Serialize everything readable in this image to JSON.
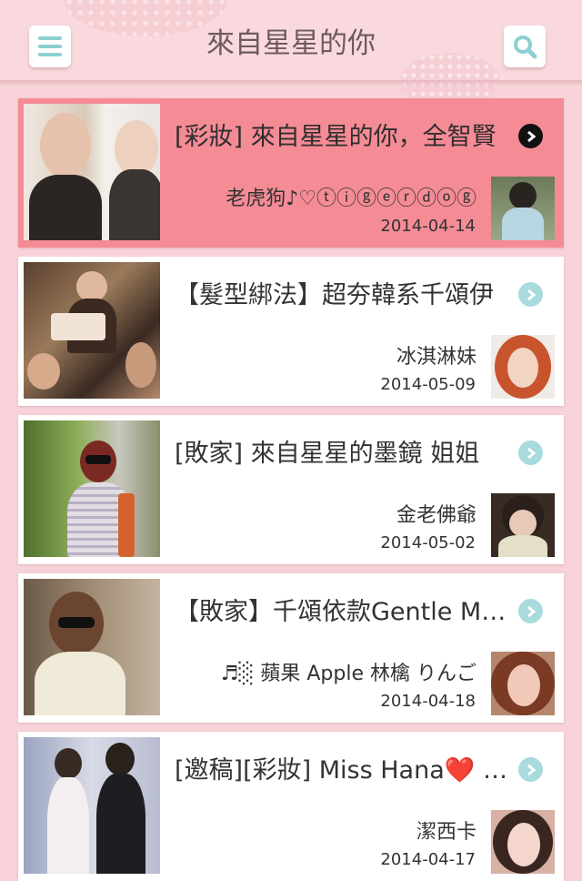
{
  "header": {
    "title": "來自星星的你",
    "menu_icon": "menu-icon",
    "search_icon": "search-icon"
  },
  "colors": {
    "background": "#f7d2d8",
    "selected_row": "#f58b95",
    "accent": "#8ccfd1"
  },
  "posts": [
    {
      "title": "[彩妝] 來自星星的你，全智賢",
      "author": "老虎狗♪♡ⓣⓘⓖⓔⓡⓓⓞⓖ",
      "date": "2014-04-14",
      "selected": true
    },
    {
      "title": "【髮型綁法】超夯韓系千頌伊",
      "author": "冰淇淋妹",
      "date": "2014-05-09",
      "selected": false
    },
    {
      "title": "[敗家] 來自星星的墨鏡  姐姐",
      "author": "金老佛爺",
      "date": "2014-05-02",
      "selected": false
    },
    {
      "title": "【敗家】千頌依款Gentle Monster",
      "author": "♬░ 蘋果 Apple 林檎 りんご",
      "date": "2014-04-18",
      "selected": false
    },
    {
      "title": "[邀稿][彩妝] Miss Hana❤️ 千頌伊",
      "author": "潔西卡",
      "date": "2014-04-17",
      "selected": false
    }
  ]
}
